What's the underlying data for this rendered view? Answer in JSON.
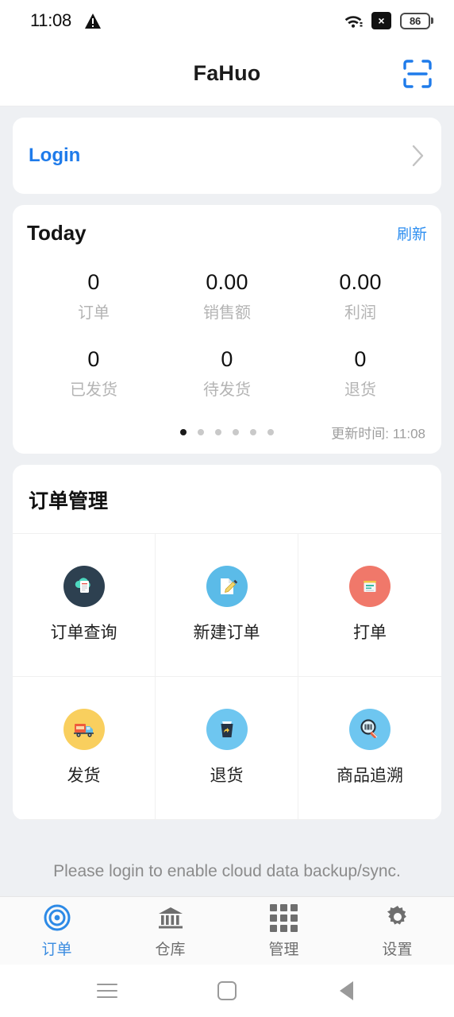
{
  "status_bar": {
    "time": "11:08",
    "warning_icon": "warning-triangle-icon",
    "wifi_icon": "wifi-icon",
    "x_badge": "×",
    "battery_level": "86"
  },
  "header": {
    "title": "FaHuo",
    "scan_icon": "scan-icon",
    "scan_color": "#1f7bea"
  },
  "login_card": {
    "label": "Login",
    "chevron_icon": "chevron-right-icon",
    "accent": "#1f7bea"
  },
  "today_card": {
    "title": "Today",
    "refresh_label": "刷新",
    "refresh_color": "#2d8ef0",
    "stats_row1": [
      {
        "value": "0",
        "label": "订单"
      },
      {
        "value": "0.00",
        "label": "销售额"
      },
      {
        "value": "0.00",
        "label": "利润"
      }
    ],
    "stats_row2": [
      {
        "value": "0",
        "label": "已发货"
      },
      {
        "value": "0",
        "label": "待发货"
      },
      {
        "value": "0",
        "label": "退货"
      }
    ],
    "dots_total": 6,
    "dots_active_index": 0,
    "updated_text": "更新时间: 11:08"
  },
  "order_management": {
    "title": "订单管理",
    "items": [
      {
        "label": "订单查询",
        "icon": "cloud-document-icon",
        "bg": "#2d4050"
      },
      {
        "label": "新建订单",
        "icon": "document-pencil-icon",
        "bg": "#5bbbe8"
      },
      {
        "label": "打单",
        "icon": "printer-icon",
        "bg": "#f0786a"
      },
      {
        "label": "发货",
        "icon": "delivery-truck-icon",
        "bg": "#f9cf5e"
      },
      {
        "label": "退货",
        "icon": "recycle-bin-icon",
        "bg": "#6ec6f0"
      },
      {
        "label": "商品追溯",
        "icon": "barcode-search-icon",
        "bg": "#6ec6f0"
      }
    ]
  },
  "notice": {
    "text": "Please login to enable cloud data backup/sync."
  },
  "tab_bar": {
    "active_index": 0,
    "active_color": "#3b8ce0",
    "inactive_color": "#6e6e6e",
    "tabs": [
      {
        "label": "订单",
        "icon": "target-icon"
      },
      {
        "label": "仓库",
        "icon": "bank-building-icon"
      },
      {
        "label": "管理",
        "icon": "grid-3x3-icon"
      },
      {
        "label": "设置",
        "icon": "gear-icon"
      }
    ]
  },
  "android_nav": {
    "recents_icon": "menu-lines-icon",
    "home_icon": "square-icon",
    "back_icon": "triangle-back-icon"
  }
}
